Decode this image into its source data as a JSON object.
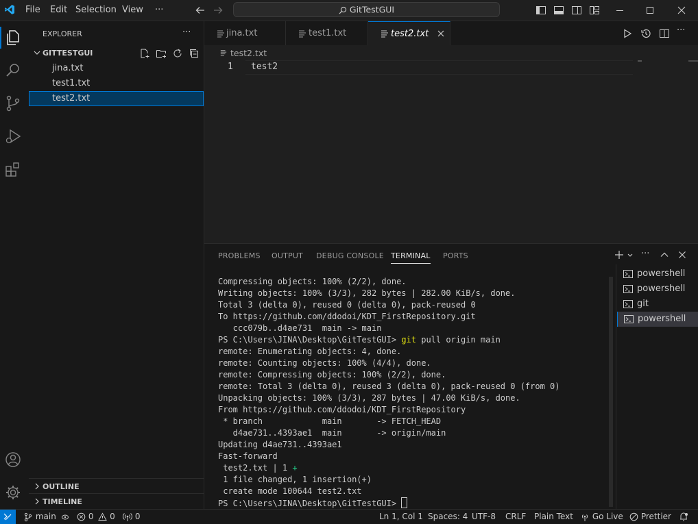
{
  "menu": {
    "file": "File",
    "edit": "Edit",
    "selection": "Selection",
    "view": "View",
    "more": "···"
  },
  "search": {
    "label": "GitTestGUI"
  },
  "sidebar": {
    "title": "EXPLORER",
    "more": "···",
    "folder": "GITTESTGUI",
    "files": [
      {
        "name": "jina.txt"
      },
      {
        "name": "test1.txt"
      },
      {
        "name": "test2.txt"
      }
    ],
    "outline": "OUTLINE",
    "timeline": "TIMELINE"
  },
  "tabs": [
    {
      "label": "jina.txt"
    },
    {
      "label": "test1.txt"
    },
    {
      "label": "test2.txt"
    }
  ],
  "editor": {
    "breadcrumb": "test2.txt",
    "lines": [
      {
        "num": "1",
        "text": "test2"
      }
    ]
  },
  "panel": {
    "tabs": [
      "PROBLEMS",
      "OUTPUT",
      "DEBUG CONSOLE",
      "TERMINAL",
      "PORTS"
    ],
    "active_tab": "TERMINAL",
    "terminals": [
      "powershell",
      "powershell",
      "git",
      "powershell"
    ],
    "terminal_lines": [
      "Compressing objects: 100% (2/2), done.",
      "Writing objects: 100% (3/3), 282 bytes | 282.00 KiB/s, done.",
      "Total 3 (delta 0), reused 0 (delta 0), pack-reused 0",
      "To https://github.com/ddodoi/KDT_FirstRepository.git",
      "   ccc079b..d4ae731  main -> main",
      {
        "prompt": "PS C:\\Users\\JINA\\Desktop\\GitTestGUI> ",
        "cmd": "git",
        "args": " pull origin main"
      },
      "remote: Enumerating objects: 4, done.",
      "remote: Counting objects: 100% (4/4), done.",
      "remote: Compressing objects: 100% (2/2), done.",
      "remote: Total 3 (delta 0), reused 3 (delta 0), pack-reused 0 (from 0)",
      "Unpacking objects: 100% (3/3), 287 bytes | 47.00 KiB/s, done.",
      "From https://github.com/ddodoi/KDT_FirstRepository",
      " * branch            main       -> FETCH_HEAD",
      "   d4ae731..4393ae1  main       -> origin/main",
      "Updating d4ae731..4393ae1",
      "Fast-forward",
      {
        "text": " test2.txt | 1 ",
        "plus": "+"
      },
      " 1 file changed, 1 insertion(+)",
      " create mode 100644 test2.txt",
      {
        "prompt": "PS C:\\Users\\JINA\\Desktop\\GitTestGUI> ",
        "cursor": true
      }
    ]
  },
  "statusbar": {
    "branch": "main",
    "errors": "0",
    "warnings": "0",
    "ports": "0",
    "position": "Ln 1, Col 1",
    "spaces": "Spaces: 4",
    "encoding": "UTF-8",
    "eol": "CRLF",
    "language": "Plain Text",
    "golive": "Go Live",
    "prettier": "Prettier"
  },
  "colors": {
    "accent": "#0078d4",
    "cmd_yellow": "#e5e510",
    "plus_green": "#23d18b",
    "remote_blue": "#0e639c"
  }
}
